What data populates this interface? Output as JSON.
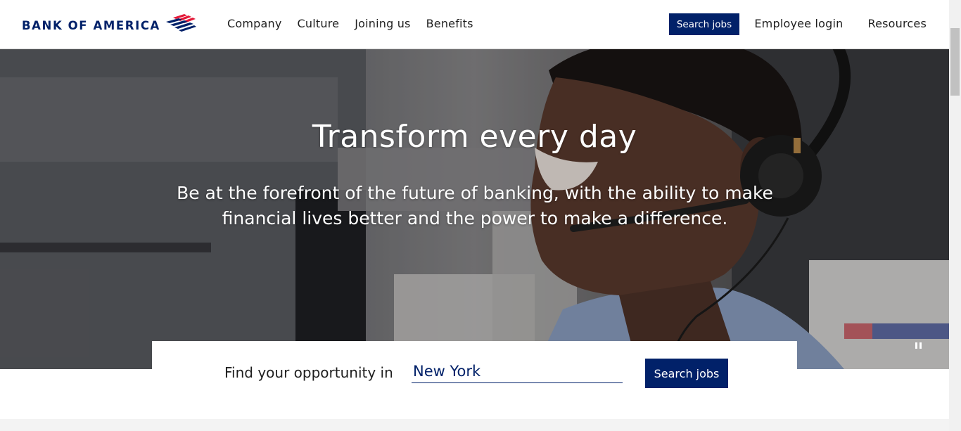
{
  "header": {
    "logo_text": "BANK OF AMERICA",
    "nav": [
      "Company",
      "Culture",
      "Joining us",
      "Benefits"
    ],
    "search_button": "Search jobs",
    "right_links": [
      "Employee login",
      "Resources"
    ]
  },
  "hero": {
    "title": "Transform every day",
    "subtitle": "Be at the forefront of the future of banking, with the ability to make financial lives better and the power to make a difference."
  },
  "search_panel": {
    "label": "Find your opportunity in",
    "location_value": "New York",
    "button": "Search jobs"
  },
  "colors": {
    "brand_navy": "#012169",
    "brand_red": "#E31837"
  },
  "icons": [
    "bank-of-america-flag-icon",
    "pause-icon"
  ]
}
